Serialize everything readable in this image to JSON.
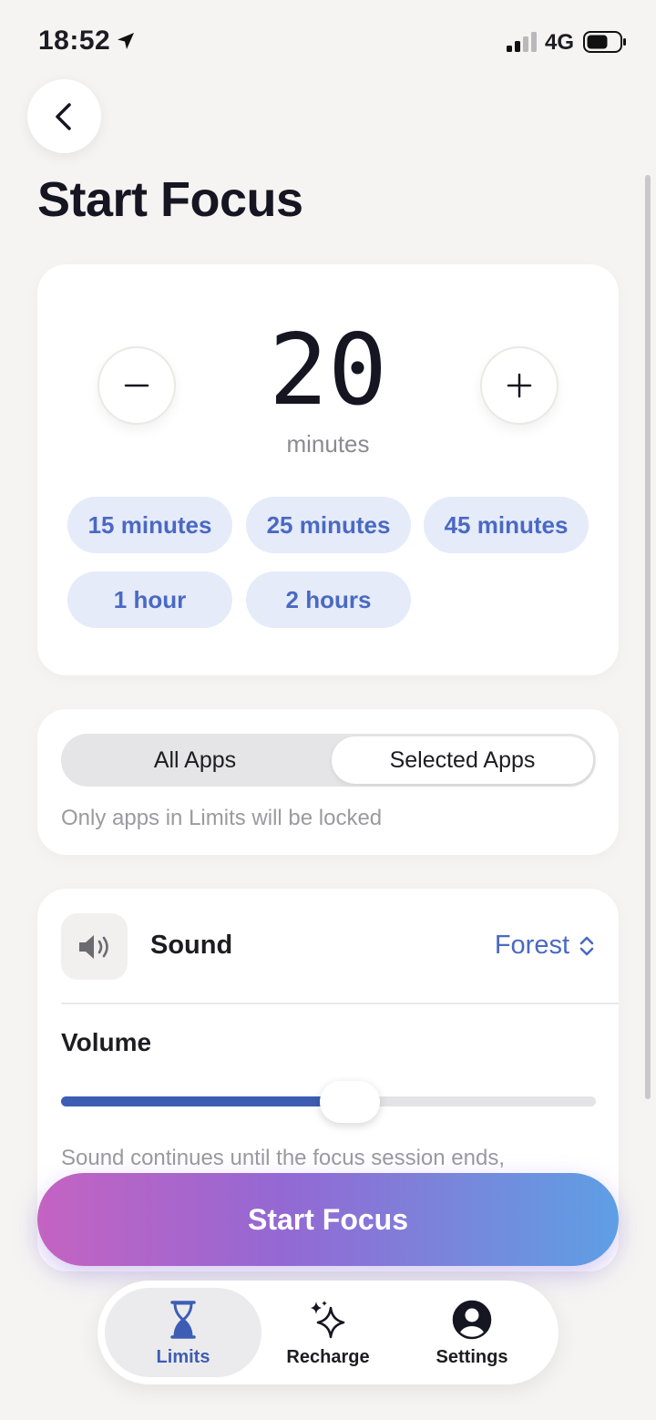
{
  "status_bar": {
    "time": "18:52",
    "network": "4G"
  },
  "page": {
    "title": "Start Focus"
  },
  "timer": {
    "value": "20",
    "unit": "minutes",
    "presets": [
      "15 minutes",
      "25 minutes",
      "45 minutes",
      "1 hour",
      "2 hours"
    ]
  },
  "apps": {
    "options": [
      "All Apps",
      "Selected Apps"
    ],
    "selected": "Selected Apps",
    "hint": "Only apps in Limits will be locked"
  },
  "sound": {
    "label": "Sound",
    "value": "Forest",
    "volume_label": "Volume",
    "volume_level": 0.54,
    "note": "Sound continues until the focus session ends,"
  },
  "start_button": {
    "label": "Start Focus"
  },
  "tab_bar": {
    "items": [
      {
        "label": "Limits",
        "icon": "hourglass-icon",
        "active": true
      },
      {
        "label": "Recharge",
        "icon": "sparkles-icon",
        "active": false
      },
      {
        "label": "Settings",
        "icon": "person-circle-icon",
        "active": false
      }
    ]
  },
  "colors": {
    "accent": "#3d5db5",
    "chip_bg": "#e5ebf9",
    "chip_text": "#4a69c3",
    "background": "#f5f4f2"
  }
}
